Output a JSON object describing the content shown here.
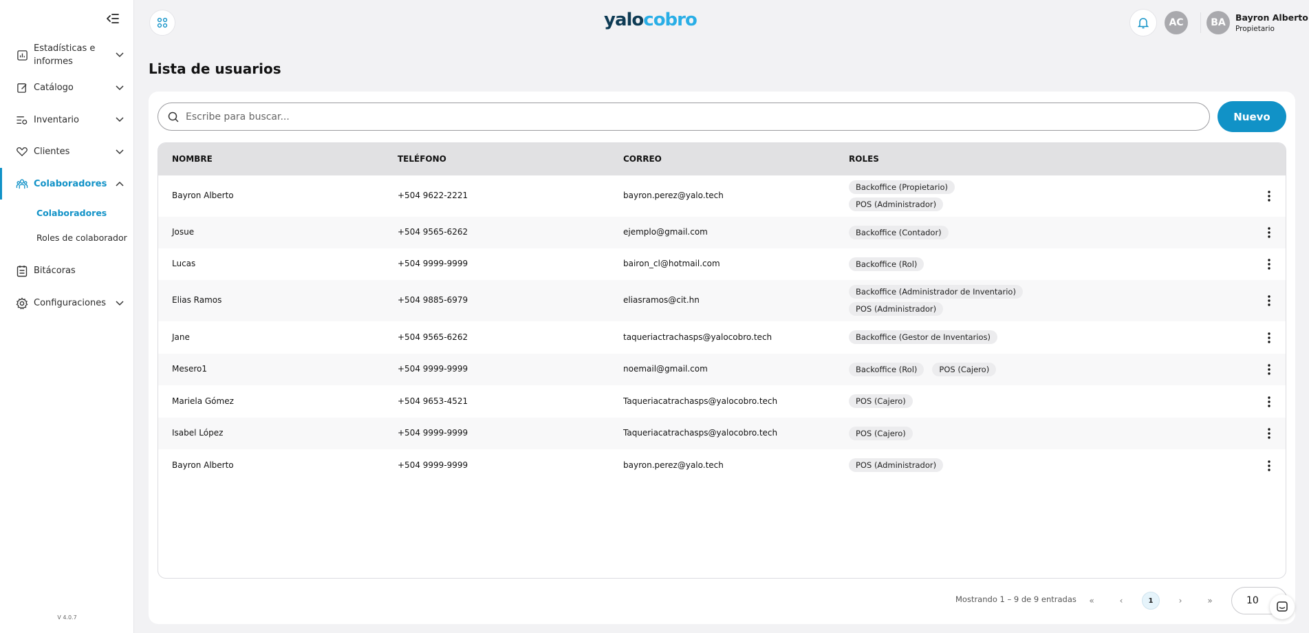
{
  "app": {
    "logo_part1": "yalo",
    "logo_part2": "cobro",
    "version": "V 4.0.7",
    "accent_color": "#1192c7"
  },
  "sidebar": {
    "items": [
      {
        "label": "Estadísticas e informes",
        "icon": "stats-report-icon",
        "expanded": false
      },
      {
        "label": "Catálogo",
        "icon": "catalog-edit-icon",
        "expanded": false
      },
      {
        "label": "Inventario",
        "icon": "inventory-settings-icon",
        "expanded": false
      },
      {
        "label": "Clientes",
        "icon": "handshake-heart-icon",
        "expanded": false
      },
      {
        "label": "Colaboradores",
        "icon": "team-icon",
        "expanded": true,
        "active": true
      },
      {
        "label": "Bitácoras",
        "icon": "clipboard-icon"
      },
      {
        "label": "Configuraciones",
        "icon": "gear-icon",
        "expanded": false
      }
    ],
    "subitems": [
      {
        "label": "Colaboradores",
        "active": true
      },
      {
        "label": "Roles de colaborador",
        "active": false
      }
    ]
  },
  "header": {
    "user_initials_secondary": "AC",
    "user_initials": "BA",
    "user_name": "Bayron Alberto",
    "user_role": "Propietario"
  },
  "main": {
    "title": "Lista de usuarios",
    "search_placeholder": "Escribe para buscar...",
    "new_button": "Nuevo"
  },
  "table": {
    "columns": [
      "NOMBRE",
      "TELÉFONO",
      "CORREO",
      "ROLES"
    ],
    "rows": [
      {
        "name": "Bayron Alberto",
        "phone": "+504 9622-2221",
        "email": "bayron.perez@yalo.tech",
        "roles": [
          "Backoffice (Propietario)",
          "POS (Administrador)"
        ]
      },
      {
        "name": "Josue",
        "phone": "+504 9565-6262",
        "email": "ejemplo@gmail.com",
        "roles": [
          "Backoffice (Contador)"
        ]
      },
      {
        "name": "Lucas",
        "phone": "+504 9999-9999",
        "email": "bairon_cl@hotmail.com",
        "roles": [
          "Backoffice (Rol)"
        ]
      },
      {
        "name": "Elias Ramos",
        "phone": "+504 9885-6979",
        "email": "eliasramos@cit.hn",
        "roles": [
          "Backoffice (Administrador de Inventario)",
          "POS (Administrador)"
        ]
      },
      {
        "name": "Jane",
        "phone": "+504 9565-6262",
        "email": "taqueriactrachasps@yalocobro.tech",
        "roles": [
          "Backoffice (Gestor de Inventarios)"
        ]
      },
      {
        "name": "Mesero1",
        "phone": "+504 9999-9999",
        "email": "noemail@gmail.com",
        "roles": [
          "Backoffice (Rol)",
          "POS (Cajero)"
        ]
      },
      {
        "name": "Mariela Gómez",
        "phone": "+504 9653-4521",
        "email": "Taqueriacatrachasps@yalocobro.tech",
        "roles": [
          "POS (Cajero)"
        ]
      },
      {
        "name": "Isabel López",
        "phone": "+504 9999-9999",
        "email": "Taqueriacatrachasps@yalocobro.tech",
        "roles": [
          "POS (Cajero)"
        ]
      },
      {
        "name": "Bayron Alberto",
        "phone": "+504 9999-9999",
        "email": "bayron.perez@yalo.tech",
        "roles": [
          "POS (Administrador)"
        ]
      }
    ]
  },
  "pagination": {
    "info": "Mostrando 1 – 9 de 9 entradas",
    "first": "«",
    "prev": "‹",
    "current_page": "1",
    "next": "›",
    "last": "»",
    "page_size": "10"
  }
}
